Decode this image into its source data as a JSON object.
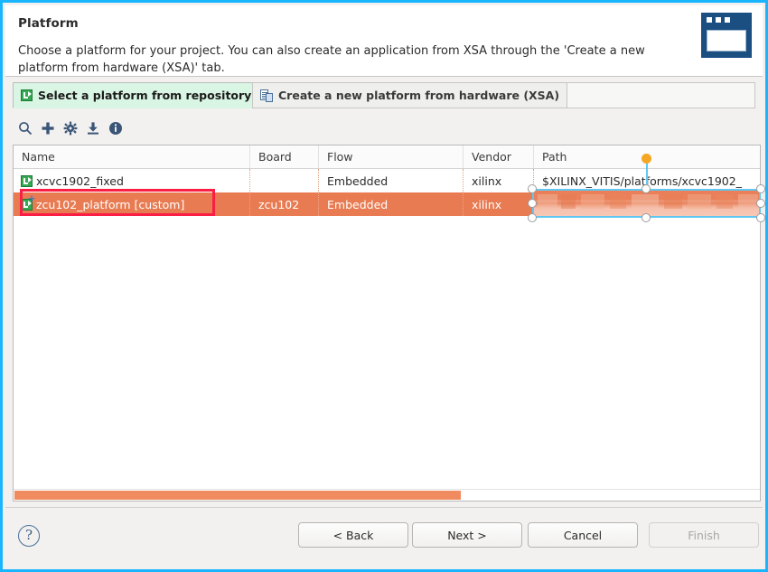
{
  "window": {
    "title": "Platform",
    "description": "Choose a platform for your project. You can also create an application from XSA through the 'Create a new platform from hardware (XSA)' tab.",
    "icon": "wizard-window-icon",
    "border_color": "#19b5fe"
  },
  "tabs": [
    {
      "label": "Select a platform from repository",
      "icon": "platform-icon",
      "active": true
    },
    {
      "label": "Create a new platform from hardware (XSA)",
      "icon": "xsa-import-icon",
      "active": false
    }
  ],
  "toolbar": {
    "buttons": [
      {
        "name": "search-icon",
        "glyph": "search"
      },
      {
        "name": "add-icon",
        "glyph": "plus"
      },
      {
        "name": "gear-icon",
        "glyph": "gear"
      },
      {
        "name": "import-icon",
        "glyph": "download"
      },
      {
        "name": "info-icon",
        "glyph": "info"
      }
    ]
  },
  "table": {
    "columns": [
      "Name",
      "Board",
      "Flow",
      "Vendor",
      "Path"
    ],
    "rows": [
      {
        "name": "xcvc1902_fixed",
        "board": "",
        "flow": "Embedded",
        "vendor": "xilinx",
        "path": "$XILINX_VITIS/platforms/xcvc1902_",
        "selected": false,
        "custom": false
      },
      {
        "name": "zcu102_platform [custom]",
        "board": "zcu102",
        "flow": "Embedded",
        "vendor": "xilinx",
        "path": "",
        "selected": true,
        "custom": true
      }
    ],
    "selected_row_color": "#e87b52",
    "scrollbar_color": "#ef8b5f"
  },
  "annotations": {
    "highlight_box": {
      "name": "red-highlight-box",
      "color": "#fa1e44"
    },
    "redaction": {
      "name": "redaction-selection-box",
      "border_color": "#5ec8f2",
      "rotation_handle_color": "#f5a623"
    }
  },
  "footer": {
    "help": "?",
    "buttons": [
      {
        "label": "< Back",
        "name": "back-button",
        "disabled": false
      },
      {
        "label": "Next >",
        "name": "next-button",
        "disabled": false
      },
      {
        "label": "Cancel",
        "name": "cancel-button",
        "disabled": false
      },
      {
        "label": "Finish",
        "name": "finish-button",
        "disabled": true
      }
    ]
  }
}
